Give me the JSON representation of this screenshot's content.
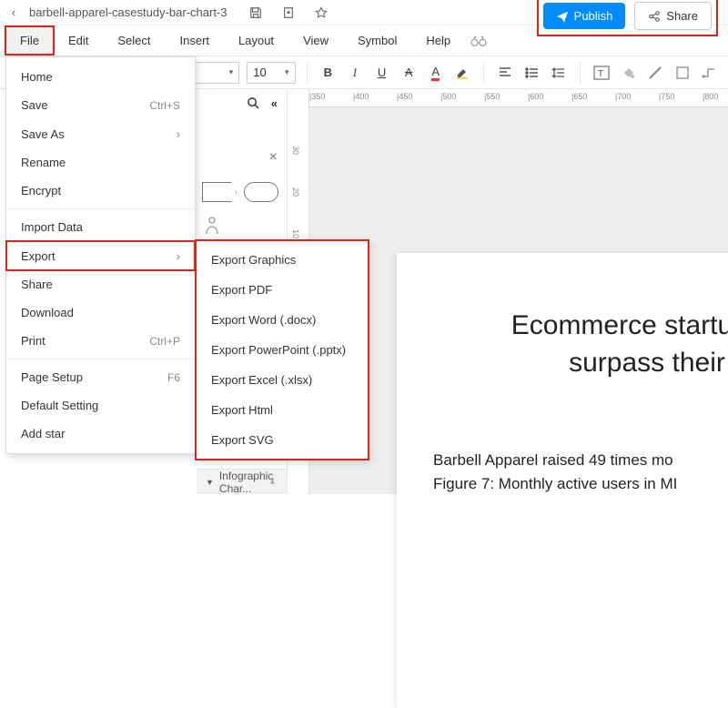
{
  "titlebar": {
    "filename": "barbell-apparel-casestudy-bar-chart-3",
    "publish": "Publish",
    "share": "Share"
  },
  "menubar": {
    "file": "File",
    "edit": "Edit",
    "select": "Select",
    "insert": "Insert",
    "layout": "Layout",
    "view": "View",
    "symbol": "Symbol",
    "help": "Help"
  },
  "toolbar": {
    "font_size": "10"
  },
  "file_menu": {
    "home": "Home",
    "save": "Save",
    "save_sc": "Ctrl+S",
    "save_as": "Save As",
    "rename": "Rename",
    "encrypt": "Encrypt",
    "import": "Import Data",
    "export": "Export",
    "share": "Share",
    "download": "Download",
    "print": "Print",
    "print_sc": "Ctrl+P",
    "page_setup": "Page Setup",
    "page_setup_sc": "F6",
    "default_setting": "Default Setting",
    "add_star": "Add star"
  },
  "export_menu": {
    "graphics": "Export Graphics",
    "pdf": "Export PDF",
    "word": "Export Word (.docx)",
    "ppt": "Export PowerPoint (.pptx)",
    "excel": "Export Excel (.xlsx)",
    "html": "Export Html",
    "svg": "Export SVG"
  },
  "sidepanel": {
    "accordion": "Infographic Char..."
  },
  "ruler": {
    "h": [
      "|350",
      "|400",
      "|450",
      "|500",
      "|550",
      "|600",
      "|650",
      "|700",
      "|750",
      "|800"
    ],
    "v": [
      "30",
      "20",
      "10"
    ]
  },
  "document": {
    "title_l1": "Ecommerce startup Barbe",
    "title_l2": "surpass their Kic",
    "body_l1": "Barbell Apparel raised 49 times mo",
    "body_l2": "Figure 7: Monthly active users in MI"
  }
}
